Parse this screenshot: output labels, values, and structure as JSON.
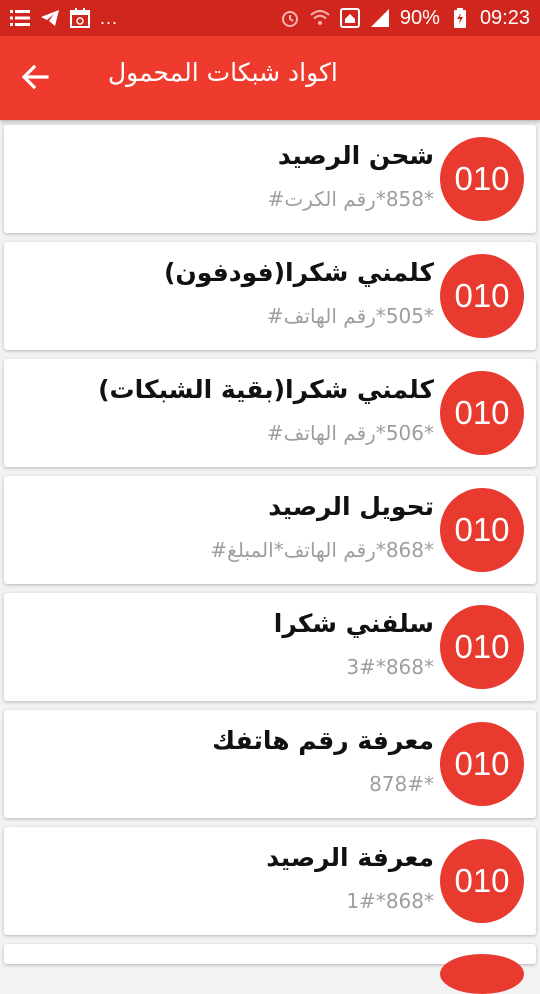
{
  "status_bar": {
    "battery": "90%",
    "time": "09:23",
    "more": "..."
  },
  "app_bar": {
    "title": "اكواد شبكات المحمول"
  },
  "items": [
    {
      "badge": "010",
      "title": "شحن الرصيد",
      "code": "*858*رقم الكرت#"
    },
    {
      "badge": "010",
      "title": "كلمني شكرا(فودفون)",
      "code": "*505*رقم الهاتف#"
    },
    {
      "badge": "010",
      "title": "كلمني شكرا(بقية الشبكات)",
      "code": "*506*رقم الهاتف#"
    },
    {
      "badge": "010",
      "title": "تحويل الرصيد",
      "code": "*868*رقم الهاتف*المبلغ#"
    },
    {
      "badge": "010",
      "title": "سلفني شكرا",
      "code": "*868*3#"
    },
    {
      "badge": "010",
      "title": "معرفة رقم هاتفك",
      "code": "*878#"
    },
    {
      "badge": "010",
      "title": "معرفة الرصيد",
      "code": "*868*1#"
    }
  ],
  "colors": {
    "status_bar": "#d0261e",
    "app_bar": "#ef3b2d",
    "badge": "#e83a2f"
  }
}
